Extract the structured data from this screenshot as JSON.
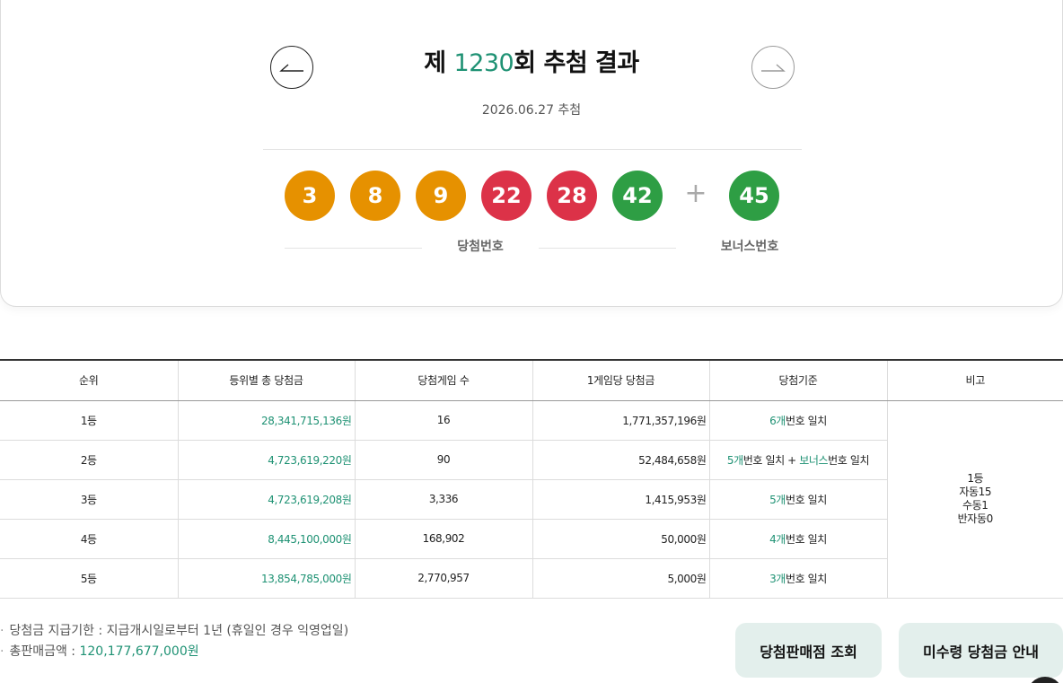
{
  "header": {
    "title_prefix": "제 ",
    "draw_number": "1230",
    "title_suffix": "회 추첨 결과",
    "draw_date": "2026.06.27 추첨",
    "prev_icon": "arrow-left-icon",
    "next_icon": "arrow-right-icon"
  },
  "balls": {
    "winning": [
      {
        "number": "3",
        "color": "#e69100"
      },
      {
        "number": "8",
        "color": "#e69100"
      },
      {
        "number": "9",
        "color": "#e69100"
      },
      {
        "number": "22",
        "color": "#dc3248"
      },
      {
        "number": "28",
        "color": "#dc3248"
      },
      {
        "number": "42",
        "color": "#2e9e44"
      }
    ],
    "plus": "+",
    "bonus": {
      "number": "45",
      "color": "#2e9e44"
    },
    "winning_label": "당첨번호",
    "bonus_label": "보너스번호"
  },
  "table": {
    "headers": [
      "순위",
      "등위별 총 당첨금",
      "당첨게임 수",
      "1게임당 당첨금",
      "당첨기준",
      "비고"
    ],
    "rows": [
      {
        "rank": "1등",
        "total": "28,341,715,136원",
        "games": "16",
        "per_game": "1,771,357,196원",
        "criteria": [
          {
            "t": "6개",
            "hl": true
          },
          {
            "t": "번호 일치",
            "hl": false
          }
        ]
      },
      {
        "rank": "2등",
        "total": "4,723,619,220원",
        "games": "90",
        "per_game": "52,484,658원",
        "criteria": [
          {
            "t": "5개",
            "hl": true
          },
          {
            "t": "번호 일치 + ",
            "hl": false
          },
          {
            "t": "보너스",
            "hl": true
          },
          {
            "t": "번호 일치",
            "hl": false
          }
        ]
      },
      {
        "rank": "3등",
        "total": "4,723,619,208원",
        "games": "3,336",
        "per_game": "1,415,953원",
        "criteria": [
          {
            "t": "5개",
            "hl": true
          },
          {
            "t": "번호 일치",
            "hl": false
          }
        ]
      },
      {
        "rank": "4등",
        "total": "8,445,100,000원",
        "games": "168,902",
        "per_game": "50,000원",
        "criteria": [
          {
            "t": "4개",
            "hl": true
          },
          {
            "t": "번호 일치",
            "hl": false
          }
        ]
      },
      {
        "rank": "5등",
        "total": "13,854,785,000원",
        "games": "2,770,957",
        "per_game": "5,000원",
        "criteria": [
          {
            "t": "3개",
            "hl": true
          },
          {
            "t": "번호 일치",
            "hl": false
          }
        ]
      }
    ],
    "remark_lines": [
      "1등",
      "자동15",
      "수동1",
      "반자동0"
    ]
  },
  "footer": {
    "bullet": "·",
    "deadline": "당첨금 지급기한 : 지급개시일로부터 1년 (휴일인 경우 익영업일)",
    "sales_label": "총판매금액 : ",
    "sales_amount": "120,177,677,000원",
    "store_button": "당첨판매점 조회",
    "unclaimed_button": "미수령 당첨금 안내"
  },
  "colors": {
    "accent": "#1f9274",
    "button_bg": "#e3efec"
  }
}
